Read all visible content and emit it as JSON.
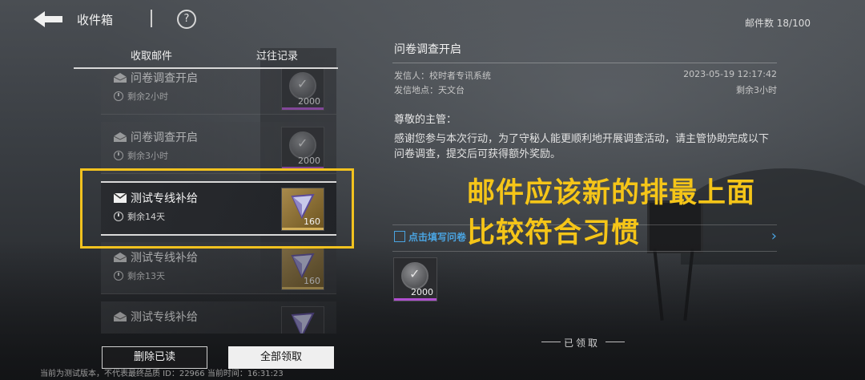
{
  "topbar": {
    "title": "收件箱",
    "help_label": "?",
    "mail_count": "邮件数 18/100"
  },
  "tabs": {
    "receive": "收取邮件",
    "history": "过往记录"
  },
  "mails": [
    {
      "title": "问卷调查开启",
      "time": "剩余2小时",
      "reward_qty": "2000",
      "reward_icon": "coin-icon",
      "state": "read"
    },
    {
      "title": "问卷调查开启",
      "time": "剩余3小时",
      "reward_qty": "2000",
      "reward_icon": "coin-icon",
      "state": "read"
    },
    {
      "title": "测试专线补给",
      "time": "剩余14天",
      "reward_qty": "160",
      "reward_icon": "crystal-icon",
      "state": "selected"
    },
    {
      "title": "测试专线补给",
      "time": "剩余13天",
      "reward_qty": "160",
      "reward_icon": "crystal-icon",
      "state": "read"
    },
    {
      "title": "测试专线补给",
      "time": "",
      "reward_qty": "",
      "reward_icon": "crystal-icon",
      "state": "read"
    }
  ],
  "buttons": {
    "delete_read": "删除已读",
    "claim_all": "全部领取"
  },
  "footer_note": "当前为测试版本，不代表最终品质 ID：22966 当前时间：16:31:23",
  "detail": {
    "title": "问卷调查开启",
    "sender_label": "发信人：校时者专讯系统",
    "date": "2023-05-19 12:17:42",
    "location_label": "发信地点：天文台",
    "remaining": "剩余3小时",
    "salutation": "尊敬的主管：",
    "body": "感谢您参与本次行动，为了守秘人能更顺利地开展调查活动，请主管协助完成以下问卷调查，提交后可获得额外奖励。",
    "survey_link": "点击填写问卷",
    "attachment_qty": "2000",
    "claimed": "已领取"
  },
  "annotation": {
    "line1": "邮件应该新的排最上面",
    "line2": "比较符合习惯",
    "color": "#f5c518"
  },
  "colors": {
    "accent_purple": "#b04fd0",
    "link_blue": "#4aa3e0",
    "highlight_yellow": "#f2c21f"
  }
}
